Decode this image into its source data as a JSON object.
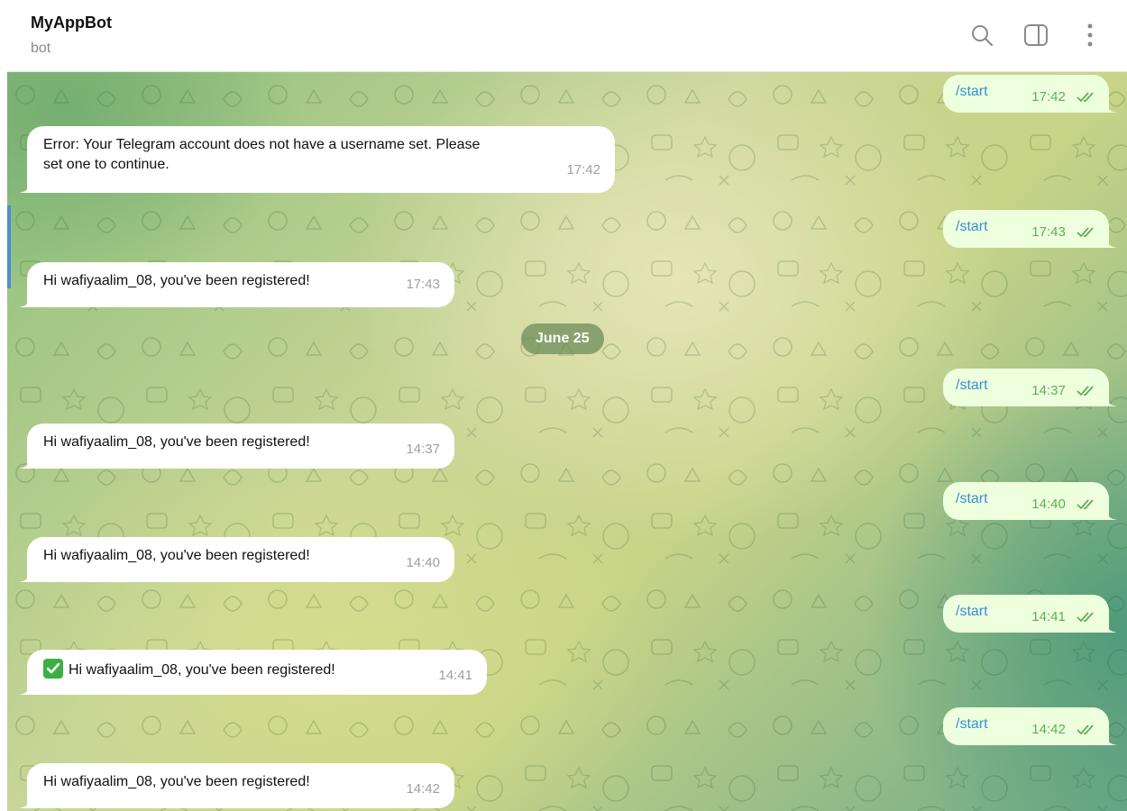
{
  "header": {
    "title": "MyAppBot",
    "subtitle": "bot",
    "icons": [
      "search-icon",
      "sidebar-toggle-icon",
      "more-vertical-icon"
    ]
  },
  "chat": {
    "date_separator": "June 25",
    "messages": [
      {
        "dir": "out",
        "text": "/start",
        "time": "17:42"
      },
      {
        "dir": "in",
        "line1": "Error: Your Telegram account does not have a username set. Please",
        "line2": "set one to continue.",
        "time": "17:42"
      },
      {
        "dir": "out",
        "text": "/start",
        "time": "17:43"
      },
      {
        "dir": "in",
        "text": "Hi wafiyaalim_08, you've been registered!",
        "time": "17:43"
      },
      {
        "dir": "out",
        "text": "/start",
        "time": "14:37"
      },
      {
        "dir": "in",
        "text": "Hi wafiyaalim_08, you've been registered!",
        "time": "14:37"
      },
      {
        "dir": "out",
        "text": "/start",
        "time": "14:40"
      },
      {
        "dir": "in",
        "text": "Hi wafiyaalim_08, you've been registered!",
        "time": "14:40"
      },
      {
        "dir": "out",
        "text": "/start",
        "time": "14:41"
      },
      {
        "dir": "in",
        "emoji": "check-mark-button-icon",
        "text": "Hi wafiyaalim_08, you've been registered!",
        "time": "14:41"
      },
      {
        "dir": "out",
        "text": "/start",
        "time": "14:42"
      },
      {
        "dir": "in",
        "text": "Hi wafiyaalim_08, you've been registered!",
        "time": "14:42"
      }
    ]
  },
  "colors": {
    "outgoing_bubble": "#eeffde",
    "incoming_bubble": "#ffffff",
    "command_link": "#3a8fd6",
    "read_checks": "#5fae57",
    "accent": "#4a8fd0"
  }
}
